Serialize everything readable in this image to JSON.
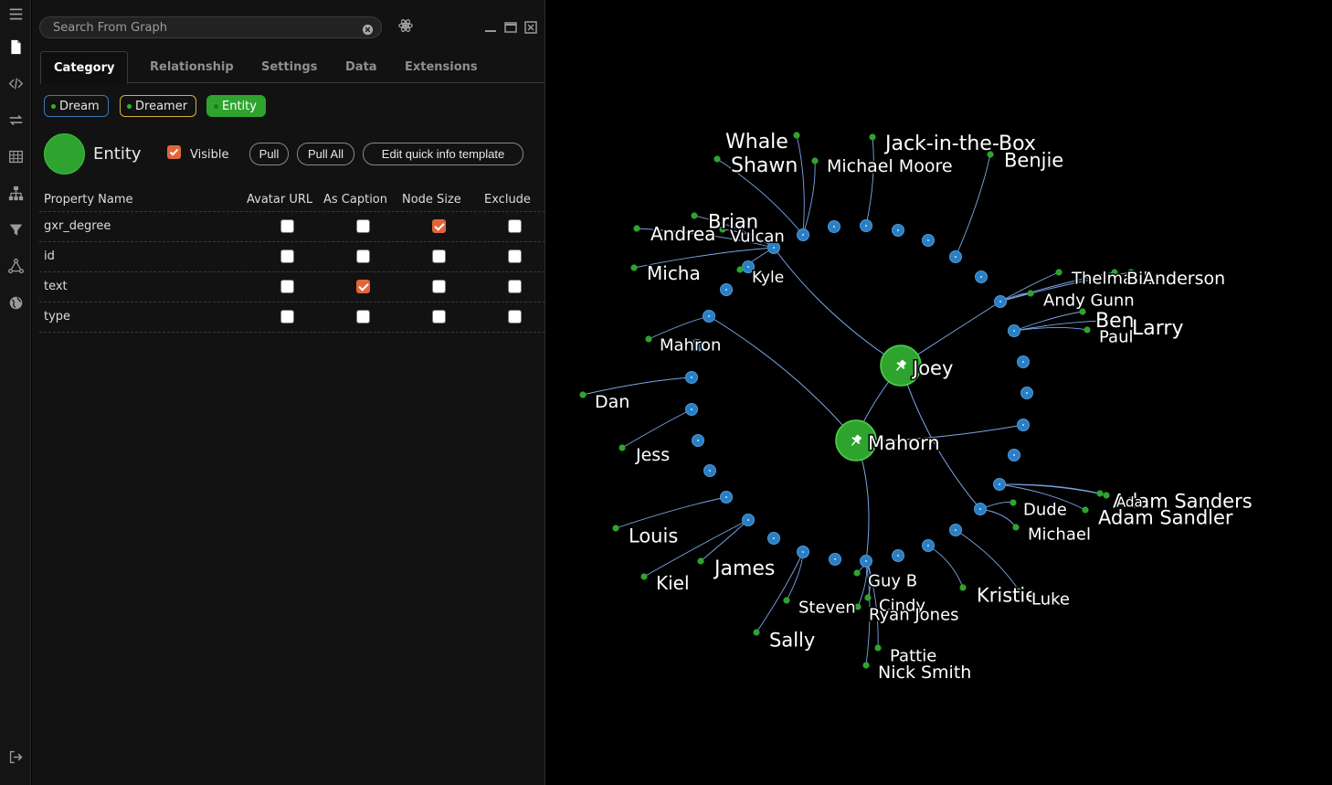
{
  "sidebar": {
    "icons": [
      "menu-icon",
      "document-icon",
      "code-icon",
      "swap-arrows-icon",
      "table-icon",
      "hierarchy-icon",
      "filter-icon",
      "network-icon",
      "globe-icon",
      "logout-icon"
    ]
  },
  "search": {
    "placeholder": "Search From Graph"
  },
  "tabs": [
    "Category",
    "Relationship",
    "Settings",
    "Data",
    "Extensions"
  ],
  "categories": [
    "Dream",
    "Dreamer",
    "Entity"
  ],
  "selected_category": {
    "name": "Entity",
    "color": "#2ea42e",
    "visible_label": "Visible",
    "visible": true,
    "buttons": {
      "pull": "Pull",
      "pull_all": "Pull All",
      "edit_template": "Edit quick info template"
    }
  },
  "property_table": {
    "headers": [
      "Property Name",
      "Avatar URL",
      "As Caption",
      "Node Size",
      "Exclude"
    ],
    "rows": [
      {
        "name": "gxr_degree",
        "avatar_url": false,
        "as_caption": false,
        "node_size": true,
        "exclude": false
      },
      {
        "name": "id",
        "avatar_url": false,
        "as_caption": false,
        "node_size": false,
        "exclude": false
      },
      {
        "name": "text",
        "avatar_url": false,
        "as_caption": true,
        "node_size": false,
        "exclude": false
      },
      {
        "name": "type",
        "avatar_url": false,
        "as_caption": false,
        "node_size": false,
        "exclude": false
      }
    ]
  },
  "colors": {
    "entity": "#2ea42e",
    "dream": "#2a7fc4",
    "edge": "#7aa6e8",
    "accent": "#e0663a"
  },
  "graph": {
    "hubs": [
      "Joey",
      "Mahorn"
    ],
    "labels": [
      "Whale",
      "Jack-in-the-Box",
      "Shawn",
      "Michael Moore",
      "Benjie",
      "Brian",
      "Andrea",
      "Vulcan",
      "Micha",
      "Kyle",
      "Thelma",
      "Bill",
      "Anderson",
      "Andy Gunn",
      "Ben",
      "Larry",
      "Paul",
      "Mahron",
      "Dan",
      "Jess",
      "Adam Sanders",
      "Ada",
      "Adam Sandler",
      "Dude",
      "Michael",
      "Louis",
      "James",
      "Kiel",
      "Guy B",
      "Cindy",
      "Ryan Jones",
      "Steven",
      "Kristie",
      "Luke",
      "Sally",
      "Pattie",
      "Nick Smith"
    ]
  }
}
